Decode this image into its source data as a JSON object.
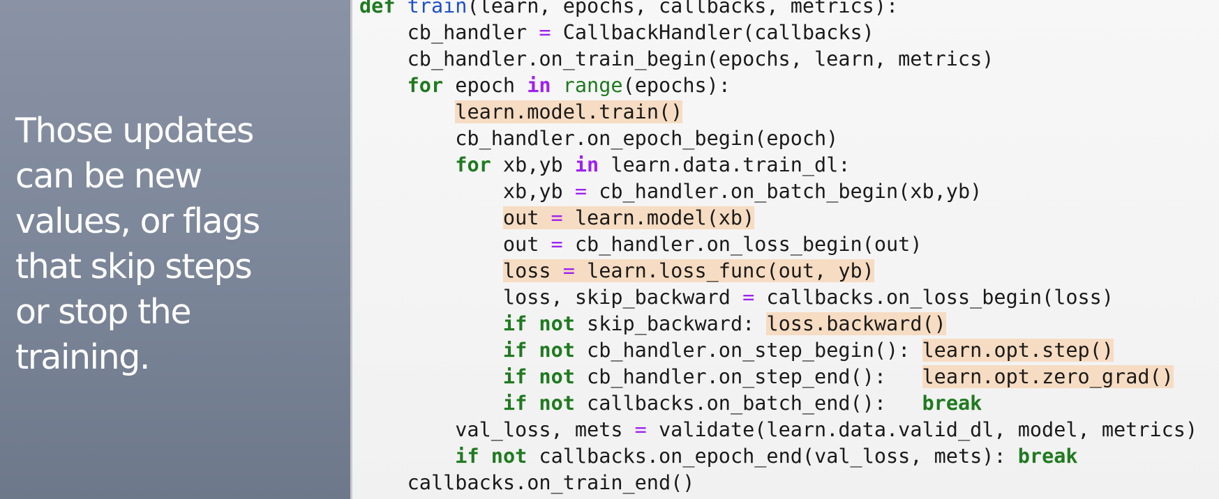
{
  "caption": {
    "lines": [
      "Those updates",
      "can be new",
      "values, or flags",
      "that skip steps",
      "or stop the",
      "training."
    ]
  },
  "code": {
    "lines": [
      [
        {
          "t": "def",
          "c": "kw"
        },
        {
          "t": " "
        },
        {
          "t": "train",
          "c": "fn"
        },
        {
          "t": "(learn, epochs, callbacks, metrics):"
        }
      ],
      [
        {
          "t": "    cb_handler "
        },
        {
          "t": "=",
          "c": "op"
        },
        {
          "t": " CallbackHandler(callbacks)"
        }
      ],
      [
        {
          "t": "    cb_handler.on_train_begin(epochs, learn, metrics)"
        }
      ],
      [
        {
          "t": "    "
        },
        {
          "t": "for",
          "c": "kw"
        },
        {
          "t": " epoch "
        },
        {
          "t": "in",
          "c": "kw-op"
        },
        {
          "t": " "
        },
        {
          "t": "range",
          "c": "builtin"
        },
        {
          "t": "(epochs):"
        }
      ],
      [
        {
          "t": "        "
        },
        {
          "t": "learn.model.train()",
          "h": true
        }
      ],
      [
        {
          "t": "        cb_handler.on_epoch_begin(epoch)"
        }
      ],
      [
        {
          "t": "        "
        },
        {
          "t": "for",
          "c": "kw"
        },
        {
          "t": " xb,yb "
        },
        {
          "t": "in",
          "c": "kw-op"
        },
        {
          "t": " learn.data.train_dl:"
        }
      ],
      [
        {
          "t": "            xb,yb "
        },
        {
          "t": "=",
          "c": "op"
        },
        {
          "t": " cb_handler.on_batch_begin(xb,yb)"
        }
      ],
      [
        {
          "t": "            "
        },
        {
          "t": "out ",
          "h": true
        },
        {
          "t": "=",
          "c": "op",
          "h": true
        },
        {
          "t": " learn.model(xb)",
          "h": true
        }
      ],
      [
        {
          "t": "            out "
        },
        {
          "t": "=",
          "c": "op"
        },
        {
          "t": " cb_handler.on_loss_begin(out)"
        }
      ],
      [
        {
          "t": "            "
        },
        {
          "t": "loss ",
          "h": true
        },
        {
          "t": "=",
          "c": "op",
          "h": true
        },
        {
          "t": " learn.loss_func(out, yb)",
          "h": true
        }
      ],
      [
        {
          "t": "            loss, skip_backward "
        },
        {
          "t": "=",
          "c": "op"
        },
        {
          "t": " callbacks.on_loss_begin(loss)"
        }
      ],
      [
        {
          "t": "            "
        },
        {
          "t": "if",
          "c": "kw"
        },
        {
          "t": " "
        },
        {
          "t": "not",
          "c": "kw"
        },
        {
          "t": " skip_backward: "
        },
        {
          "t": "loss.backward()",
          "h": true
        }
      ],
      [
        {
          "t": "            "
        },
        {
          "t": "if",
          "c": "kw"
        },
        {
          "t": " "
        },
        {
          "t": "not",
          "c": "kw"
        },
        {
          "t": " cb_handler.on_step_begin(): "
        },
        {
          "t": "learn.opt.step()",
          "h": true
        }
      ],
      [
        {
          "t": "            "
        },
        {
          "t": "if",
          "c": "kw"
        },
        {
          "t": " "
        },
        {
          "t": "not",
          "c": "kw"
        },
        {
          "t": " cb_handler.on_step_end():   "
        },
        {
          "t": "learn.opt.zero_grad()",
          "h": true
        }
      ],
      [
        {
          "t": "            "
        },
        {
          "t": "if",
          "c": "kw"
        },
        {
          "t": " "
        },
        {
          "t": "not",
          "c": "kw"
        },
        {
          "t": " callbacks.on_batch_end():   "
        },
        {
          "t": "break",
          "c": "kw"
        }
      ],
      [
        {
          "t": "        val_loss, mets "
        },
        {
          "t": "=",
          "c": "op"
        },
        {
          "t": " validate(learn.data.valid_dl, model, metrics)"
        }
      ],
      [
        {
          "t": "        "
        },
        {
          "t": "if",
          "c": "kw"
        },
        {
          "t": " "
        },
        {
          "t": "not",
          "c": "kw"
        },
        {
          "t": " callbacks.on_epoch_end(val_loss, mets): "
        },
        {
          "t": "break",
          "c": "kw"
        }
      ],
      [
        {
          "t": "    callbacks.on_train_end()"
        }
      ]
    ]
  },
  "colors": {
    "keyword": "#1f7a1f",
    "function_name": "#1f4fc8",
    "operator": "#a020f0",
    "highlight": "#f6dcc2",
    "slide_background": "#7d879a"
  }
}
